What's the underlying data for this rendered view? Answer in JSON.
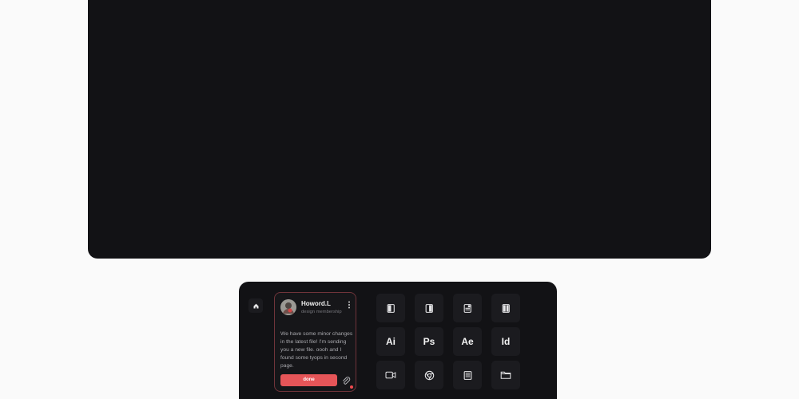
{
  "message_card": {
    "avatar_icon": "user-avatar-photo",
    "sender_name": "Howord.L",
    "sender_role": "design membership",
    "body": "We have some minor changes in the latest file! I'm sending  you a new file. oooh and I found some tyops in second page.",
    "done_label": "done",
    "attach_icon": "paperclip-icon",
    "menu_icon": "vertical-dots-icon",
    "accent_color": "#e65558"
  },
  "home": {
    "icon": "home-icon"
  },
  "keys": [
    {
      "type": "icon",
      "icon": "document-icon"
    },
    {
      "type": "icon",
      "icon": "document-icon"
    },
    {
      "type": "icon",
      "icon": "document-icon"
    },
    {
      "type": "icon",
      "icon": "document-icon"
    },
    {
      "type": "text",
      "label": "Ai"
    },
    {
      "type": "text",
      "label": "Ps"
    },
    {
      "type": "text",
      "label": "Ae"
    },
    {
      "type": "text",
      "label": "Id"
    },
    {
      "type": "icon",
      "icon": "video-icon"
    },
    {
      "type": "icon",
      "icon": "chrome-icon"
    },
    {
      "type": "icon",
      "icon": "notes-icon"
    },
    {
      "type": "icon",
      "icon": "folder-icon"
    }
  ],
  "colors": {
    "page_background": "#fafafa",
    "panel_background": "#121215",
    "key_background": "#1b1b1f"
  }
}
